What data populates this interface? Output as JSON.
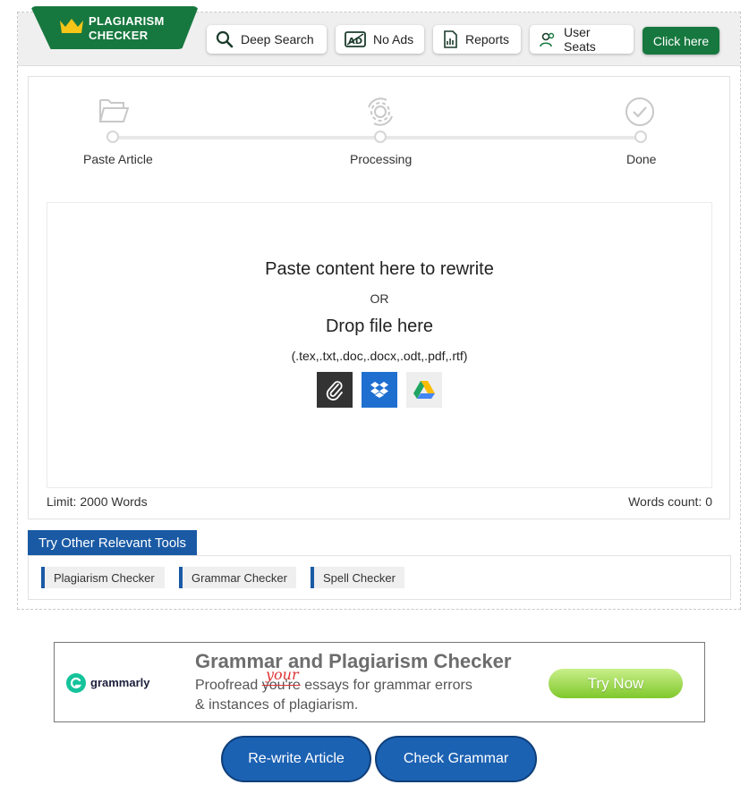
{
  "logo": {
    "line1": "PLAGIARISM",
    "line2": "CHECKER"
  },
  "nav": {
    "deep_search": "Deep Search",
    "no_ads": "No Ads",
    "reports": "Reports",
    "user_seats": "User Seats",
    "click_here": "Click here"
  },
  "steps": [
    {
      "label": "Paste Article"
    },
    {
      "label": "Processing"
    },
    {
      "label": "Done"
    }
  ],
  "drop": {
    "title": "Paste content here to rewrite",
    "or": "OR",
    "file": "Drop file here",
    "types": "(.tex,.txt,.doc,.docx,.odt,.pdf,.rtf)"
  },
  "limit": "Limit: 2000 Words",
  "words_count": "Words count: 0",
  "tools": {
    "header": "Try Other Relevant Tools",
    "items": [
      "Plagiarism Checker",
      "Grammar Checker",
      "Spell Checker"
    ]
  },
  "ad": {
    "brand": "grammarly",
    "heading": "Grammar and Plagiarism Checker",
    "line1_pre": "Proofread ",
    "line1_struck": "you're",
    "line1_post": " essays for grammar errors",
    "correction": "your",
    "line2": "& instances of plagiarism.",
    "cta": "Try Now"
  },
  "buttons": {
    "rewrite": "Re-write Article",
    "check_grammar": "Check Grammar"
  },
  "colors": {
    "brand_green": "#17783f",
    "accent_blue": "#1a5aa5",
    "button_blue": "#1c62b3"
  }
}
